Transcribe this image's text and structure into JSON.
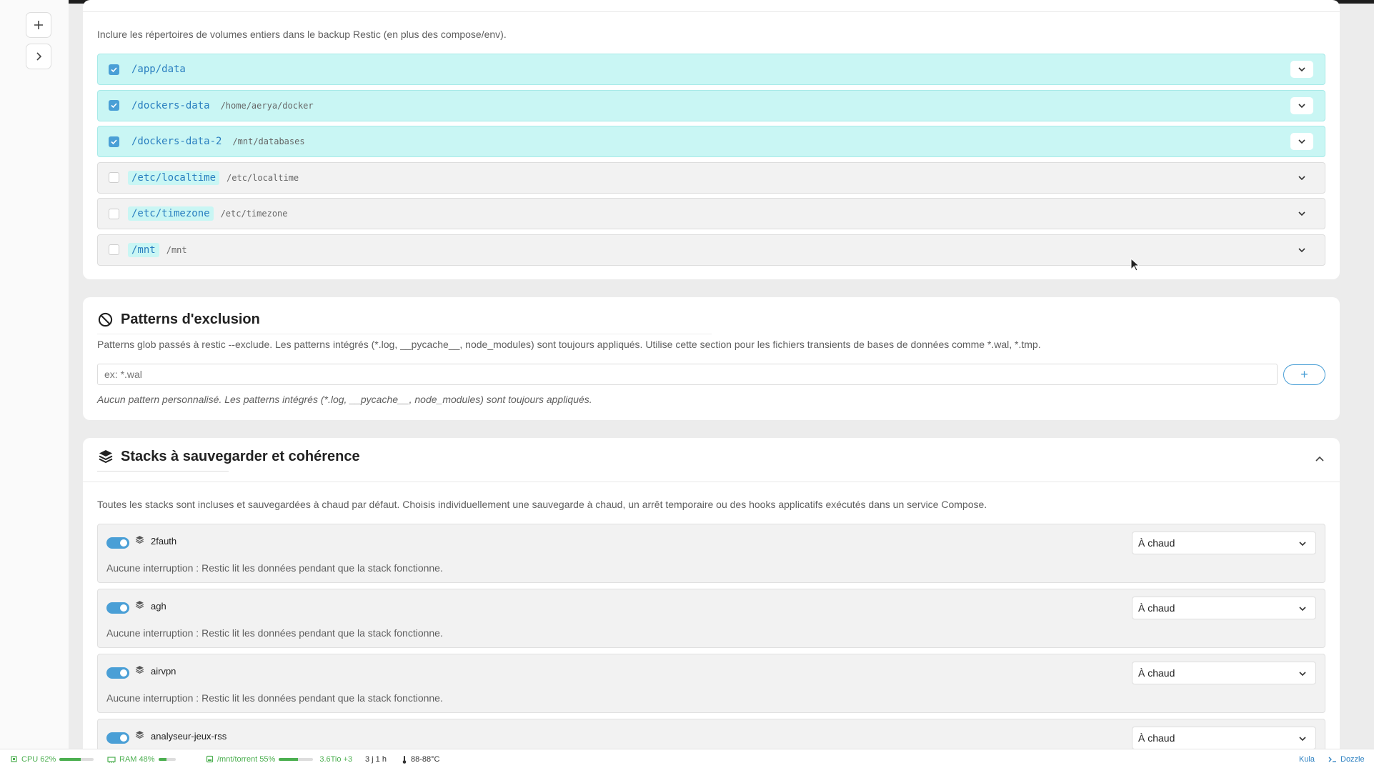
{
  "volumes_section": {
    "description": "Inclure les répertoires de volumes entiers dans le backup Restic (en plus des compose/env).",
    "items": [
      {
        "path": "/app/data",
        "source": "",
        "checked": true
      },
      {
        "path": "/dockers-data",
        "source": "/home/aerya/docker",
        "checked": true
      },
      {
        "path": "/dockers-data-2",
        "source": "/mnt/databases",
        "checked": true
      },
      {
        "path": "/etc/localtime",
        "source": "/etc/localtime",
        "checked": false
      },
      {
        "path": "/etc/timezone",
        "source": "/etc/timezone",
        "checked": false
      },
      {
        "path": "/mnt",
        "source": "/mnt",
        "checked": false
      }
    ]
  },
  "exclusion": {
    "title": "Patterns d'exclusion",
    "description": "Patterns glob passés à restic --exclude. Les patterns intégrés (*.log, __pycache__, node_modules) sont toujours appliqués. Utilise cette section pour les fichiers transients de bases de données comme *.wal, *.tmp.",
    "input_placeholder": "ex: *.wal",
    "add_label": "+",
    "empty_note": "Aucun pattern personnalisé. Les patterns intégrés (*.log, __pycache__, node_modules) sont toujours appliqués."
  },
  "stacks": {
    "title": "Stacks à sauvegarder et cohérence",
    "description": "Toutes les stacks sont incluses et sauvegardées à chaud par défaut. Choisis individuellement une sauvegarde à chaud, un arrêt temporaire ou des hooks applicatifs exécutés dans un service Compose.",
    "items": [
      {
        "name": "2fauth",
        "mode": "À chaud",
        "note": "Aucune interruption : Restic lit les données pendant que la stack fonctionne.",
        "enabled": true
      },
      {
        "name": "agh",
        "mode": "À chaud",
        "note": "Aucune interruption : Restic lit les données pendant que la stack fonctionne.",
        "enabled": true
      },
      {
        "name": "airvpn",
        "mode": "À chaud",
        "note": "Aucune interruption : Restic lit les données pendant que la stack fonctionne.",
        "enabled": true
      },
      {
        "name": "analyseur-jeux-rss",
        "mode": "À chaud",
        "note": "",
        "enabled": true
      }
    ]
  },
  "statusbar": {
    "cpu": {
      "label": "CPU 62%",
      "percent": 62
    },
    "ram": {
      "label": "RAM 48%",
      "percent": 48
    },
    "disk": {
      "label": "/mnt/torrent 55%",
      "percent": 55
    },
    "disk_size": "3.6Tio +3",
    "uptime": "3 j 1 h",
    "temp": "88-88°C",
    "kula": "Kula",
    "dozzle": "Dozzle"
  },
  "colors": {
    "accent": "#4a9fd6",
    "highlight": "#c9f6f4",
    "status_green": "#4caf50"
  }
}
